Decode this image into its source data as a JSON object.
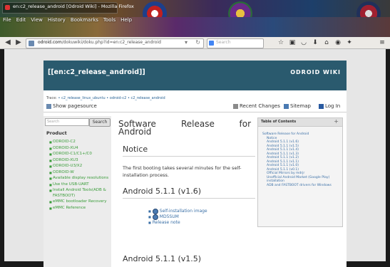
{
  "browser": {
    "tab_title": "en:c2_release_android [Odroid Wiki] - Mozilla Firefox",
    "menu": [
      "File",
      "Edit",
      "View",
      "History",
      "Bookmarks",
      "Tools",
      "Help"
    ],
    "url_host": "odroid.com",
    "url_path": "/dokuwiki/doku.php?id=en:c2_release_android",
    "search_placeholder": "Search"
  },
  "wiki": {
    "page_id": "[[en:c2_release_android]]",
    "brand": "ODROID WIKI",
    "trace": [
      "Trace:",
      "c2_release_linux_ubuntu",
      "odroid-c2",
      "c2_release_android"
    ],
    "tools": {
      "show_source": "Show pagesource",
      "recent_changes": "Recent Changes",
      "sitemap": "Sitemap",
      "login": "Log In"
    }
  },
  "sidebar": {
    "search_placeholder": "Search",
    "search_button": "Search",
    "heading": "Product",
    "items": [
      "ODROID-C2",
      "ODROID-XU4",
      "ODROID-C1/C1+/C0",
      "ODROID-XU3",
      "ODROID-U3/X2",
      "ODROID-W",
      "Available display resolutions",
      "Use the USB-UART",
      "Install Android Tools(ADB & FASTBOOT)",
      "eMMC bootloader Recovery",
      "eMMC Reference"
    ]
  },
  "content": {
    "title_parts": [
      "Software",
      "Release",
      "for",
      "Android"
    ],
    "notice_heading": "Notice",
    "notice_text": "The first booting takes several minutes for the self-installation process.",
    "section1": "Android 5.1.1 (v1.6)",
    "links": [
      "Self-installation image",
      "MD5SUM",
      "Release note"
    ],
    "section2": "Android 5.1.1 (v1.5)"
  },
  "toc": {
    "title": "Table of Contents",
    "toggle": "+",
    "items": [
      {
        "text": "Software Release for Android",
        "level": 1
      },
      {
        "text": "Notice",
        "level": 2
      },
      {
        "text": "Android 5.1.1 (v1.6)",
        "level": 2
      },
      {
        "text": "Android 5.1.1 (v1.5)",
        "level": 2
      },
      {
        "text": "Android 5.1.1 (v1.4)",
        "level": 2
      },
      {
        "text": "Android 5.1.1 (v1.3)",
        "level": 2
      },
      {
        "text": "Android 5.1.1 (v1.2)",
        "level": 2
      },
      {
        "text": "Android 5.1.1 (v1.1)",
        "level": 2
      },
      {
        "text": "Android 5.1.1 (v1.0)",
        "level": 2
      },
      {
        "text": "Android 5.1.1 (v0.1)",
        "level": 2
      },
      {
        "text": "Official Mirrors by mdrjr",
        "level": 2
      },
      {
        "text": "Unofficial Android Market (Google Play) installation",
        "level": 3
      },
      {
        "text": "ADB and FASTBOOT drivers for Windows",
        "level": 3
      }
    ]
  },
  "colors": {
    "header": "#2a5a6e",
    "link_green": "#3a9c3a",
    "link_blue": "#3a6fa6"
  }
}
